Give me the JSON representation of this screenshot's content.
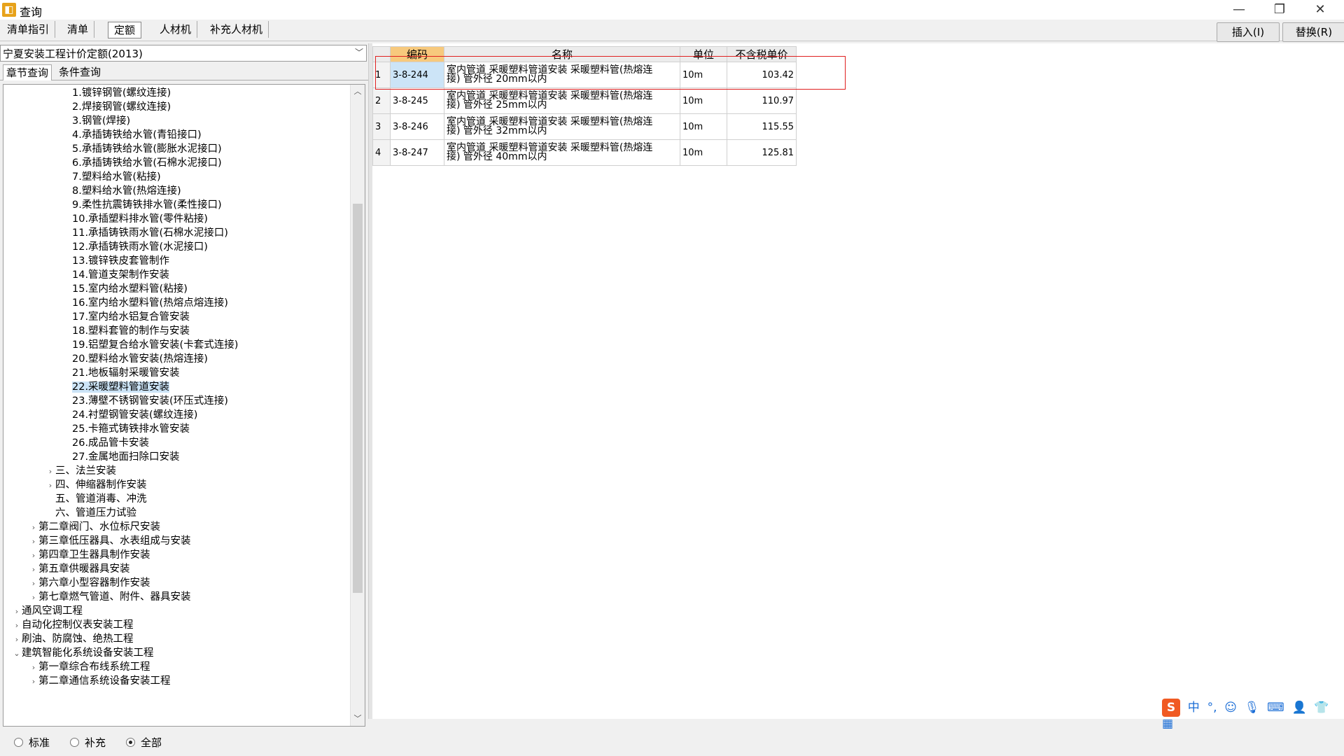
{
  "window": {
    "title": "查询",
    "minimize_glyph": "—",
    "maximize_glyph": "❐",
    "close_glyph": "✕"
  },
  "tabs": [
    "清单指引",
    "清单",
    "定额",
    "人材机",
    "补充人材机"
  ],
  "active_tab": "定额",
  "actions": {
    "insert": "插入(I)",
    "replace": "替换(R)"
  },
  "quota_library": "宁夏安装工程计价定额(2013)",
  "query_tabs": {
    "chapter": "章节查询",
    "condition": "条件查询"
  },
  "tree": [
    {
      "label": "1.镀锌钢管(螺纹连接)",
      "level": 3
    },
    {
      "label": "2.焊接钢管(螺纹连接)",
      "level": 3
    },
    {
      "label": "3.钢管(焊接)",
      "level": 3
    },
    {
      "label": "4.承插铸铁给水管(青铅接口)",
      "level": 3
    },
    {
      "label": "5.承插铸铁给水管(膨胀水泥接口)",
      "level": 3
    },
    {
      "label": "6.承插铸铁给水管(石棉水泥接口)",
      "level": 3
    },
    {
      "label": "7.塑料给水管(粘接)",
      "level": 3
    },
    {
      "label": "8.塑料给水管(热熔连接)",
      "level": 3
    },
    {
      "label": "9.柔性抗震铸铁排水管(柔性接口)",
      "level": 3
    },
    {
      "label": "10.承插塑料排水管(零件粘接)",
      "level": 3
    },
    {
      "label": "11.承插铸铁雨水管(石棉水泥接口)",
      "level": 3
    },
    {
      "label": "12.承插铸铁雨水管(水泥接口)",
      "level": 3
    },
    {
      "label": "13.镀锌铁皮套管制作",
      "level": 3
    },
    {
      "label": "14.管道支架制作安装",
      "level": 3
    },
    {
      "label": "15.室内给水塑料管(粘接)",
      "level": 3
    },
    {
      "label": "16.室内给水塑料管(热熔点熔连接)",
      "level": 3
    },
    {
      "label": "17.室内给水铝复合管安装",
      "level": 3
    },
    {
      "label": "18.塑料套管的制作与安装",
      "level": 3
    },
    {
      "label": "19.铝塑复合给水管安装(卡套式连接)",
      "level": 3
    },
    {
      "label": "20.塑料给水管安装(热熔连接)",
      "level": 3
    },
    {
      "label": "21.地板辐射采暖管安装",
      "level": 3
    },
    {
      "label": "22.采暖塑料管道安装",
      "level": 3,
      "selected": true
    },
    {
      "label": "23.薄壁不锈钢管安装(环压式连接)",
      "level": 3
    },
    {
      "label": "24.衬塑钢管安装(螺纹连接)",
      "level": 3
    },
    {
      "label": "25.卡箍式铸铁排水管安装",
      "level": 3
    },
    {
      "label": "26.成品管卡安装",
      "level": 3
    },
    {
      "label": "27.金属地面扫除口安装",
      "level": 3
    },
    {
      "label": "三、法兰安装",
      "level": 2,
      "expand": "›"
    },
    {
      "label": "四、伸缩器制作安装",
      "level": 2,
      "expand": "›"
    },
    {
      "label": "五、管道消毒、冲洗",
      "level": 2
    },
    {
      "label": "六、管道压力试验",
      "level": 2
    },
    {
      "label": "第二章阀门、水位标尺安装",
      "level": 1,
      "expand": "›"
    },
    {
      "label": "第三章低压器具、水表组成与安装",
      "level": 1,
      "expand": "›"
    },
    {
      "label": "第四章卫生器具制作安装",
      "level": 1,
      "expand": "›"
    },
    {
      "label": "第五章供暖器具安装",
      "level": 1,
      "expand": "›"
    },
    {
      "label": "第六章小型容器制作安装",
      "level": 1,
      "expand": "›"
    },
    {
      "label": "第七章燃气管道、附件、器具安装",
      "level": 1,
      "expand": "›"
    },
    {
      "label": "通风空调工程",
      "level": 0,
      "expand": "›"
    },
    {
      "label": "自动化控制仪表安装工程",
      "level": 0,
      "expand": "›"
    },
    {
      "label": "刷油、防腐蚀、绝热工程",
      "level": 0,
      "expand": "›"
    },
    {
      "label": "建筑智能化系统设备安装工程",
      "level": 0,
      "expand": "⌄"
    },
    {
      "label": "第一章综合布线系统工程",
      "level": 1,
      "expand": "›"
    },
    {
      "label": "第二章通信系统设备安装工程",
      "level": 1,
      "expand": "›"
    }
  ],
  "radios": [
    {
      "label": "标准",
      "checked": false
    },
    {
      "label": "补充",
      "checked": false
    },
    {
      "label": "全部",
      "checked": true
    }
  ],
  "grid": {
    "headers": {
      "code": "编码",
      "name": "名称",
      "unit": "单位",
      "price": "不含税单价"
    },
    "rows": [
      {
        "num": "1",
        "code": "3-8-244",
        "name_line1": "室内管道 采暖塑料管道安装 采暖塑料管(热熔连",
        "name_line2": "接) 管外径 20mm以内",
        "unit": "10m",
        "price": "103.42"
      },
      {
        "num": "2",
        "code": "3-8-245",
        "name_line1": "室内管道 采暖塑料管道安装 采暖塑料管(热熔连",
        "name_line2": "接) 管外径 25mm以内",
        "unit": "10m",
        "price": "110.97"
      },
      {
        "num": "3",
        "code": "3-8-246",
        "name_line1": "室内管道 采暖塑料管道安装 采暖塑料管(热熔连",
        "name_line2": "接) 管外径 32mm以内",
        "unit": "10m",
        "price": "115.55"
      },
      {
        "num": "4",
        "code": "3-8-247",
        "name_line1": "室内管道 采暖塑料管道安装 采暖塑料管(热熔连",
        "name_line2": "接) 管外径 40mm以内",
        "unit": "10m",
        "price": "125.81"
      }
    ]
  },
  "ime": {
    "logo": "S",
    "lang": "中"
  }
}
